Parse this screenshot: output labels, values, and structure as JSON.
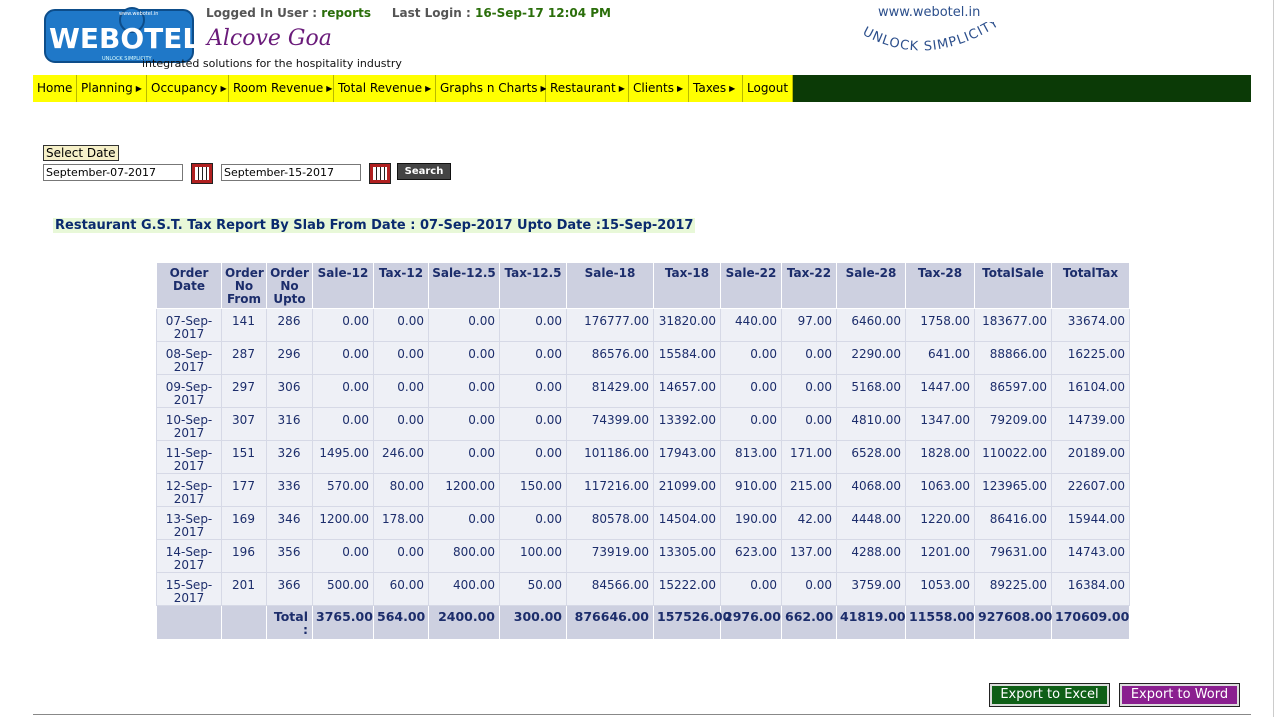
{
  "header": {
    "logo_text": "WEBOTEL",
    "logo_small_text": "www.webotel.in",
    "logo_under_text": "UNLOCK SIMPLICITY",
    "logged_in_label": "Logged In User :",
    "logged_in_user": "reports",
    "last_login_label": "Last Login :",
    "last_login_value": "16-Sep-17 12:04 PM",
    "hotel_name": "Alcove Goa",
    "tagline": "integrated solutions for the hospitality industry",
    "brand_url": "www.webotel.in",
    "brand_slogan": "UNLOCK SIMPLICITY"
  },
  "menu": [
    {
      "label": "Home",
      "has_submenu": false
    },
    {
      "label": "Planning",
      "has_submenu": true
    },
    {
      "label": "Occupancy",
      "has_submenu": true
    },
    {
      "label": "Room Revenue",
      "has_submenu": true
    },
    {
      "label": "Total Revenue",
      "has_submenu": true
    },
    {
      "label": "Graphs n Charts",
      "has_submenu": true
    },
    {
      "label": "Restaurant",
      "has_submenu": true
    },
    {
      "label": "Clients",
      "has_submenu": true
    },
    {
      "label": "Taxes",
      "has_submenu": true
    },
    {
      "label": "Logout",
      "has_submenu": false
    }
  ],
  "filter": {
    "select_date_label": "Select Date",
    "from_date": "September-07-2017",
    "to_date": "September-15-2017",
    "search_label": "Search"
  },
  "report": {
    "title": "Restaurant G.S.T. Tax Report By Slab From Date : 07-Sep-2017 Upto Date :15-Sep-2017",
    "columns": [
      "Order Date",
      "Order No From",
      "Order No Upto",
      "Sale-12",
      "Tax-12",
      "Sale-12.5",
      "Tax-12.5",
      "Sale-18",
      "Tax-18",
      "Sale-22",
      "Tax-22",
      "Sale-28",
      "Tax-28",
      "TotalSale",
      "TotalTax"
    ],
    "rows": [
      [
        "07-Sep-2017",
        "141",
        "286",
        "0.00",
        "0.00",
        "0.00",
        "0.00",
        "176777.00",
        "31820.00",
        "440.00",
        "97.00",
        "6460.00",
        "1758.00",
        "183677.00",
        "33674.00"
      ],
      [
        "08-Sep-2017",
        "287",
        "296",
        "0.00",
        "0.00",
        "0.00",
        "0.00",
        "86576.00",
        "15584.00",
        "0.00",
        "0.00",
        "2290.00",
        "641.00",
        "88866.00",
        "16225.00"
      ],
      [
        "09-Sep-2017",
        "297",
        "306",
        "0.00",
        "0.00",
        "0.00",
        "0.00",
        "81429.00",
        "14657.00",
        "0.00",
        "0.00",
        "5168.00",
        "1447.00",
        "86597.00",
        "16104.00"
      ],
      [
        "10-Sep-2017",
        "307",
        "316",
        "0.00",
        "0.00",
        "0.00",
        "0.00",
        "74399.00",
        "13392.00",
        "0.00",
        "0.00",
        "4810.00",
        "1347.00",
        "79209.00",
        "14739.00"
      ],
      [
        "11-Sep-2017",
        "151",
        "326",
        "1495.00",
        "246.00",
        "0.00",
        "0.00",
        "101186.00",
        "17943.00",
        "813.00",
        "171.00",
        "6528.00",
        "1828.00",
        "110022.00",
        "20189.00"
      ],
      [
        "12-Sep-2017",
        "177",
        "336",
        "570.00",
        "80.00",
        "1200.00",
        "150.00",
        "117216.00",
        "21099.00",
        "910.00",
        "215.00",
        "4068.00",
        "1063.00",
        "123965.00",
        "22607.00"
      ],
      [
        "13-Sep-2017",
        "169",
        "346",
        "1200.00",
        "178.00",
        "0.00",
        "0.00",
        "80578.00",
        "14504.00",
        "190.00",
        "42.00",
        "4448.00",
        "1220.00",
        "86416.00",
        "15944.00"
      ],
      [
        "14-Sep-2017",
        "196",
        "356",
        "0.00",
        "0.00",
        "800.00",
        "100.00",
        "73919.00",
        "13305.00",
        "623.00",
        "137.00",
        "4288.00",
        "1201.00",
        "79631.00",
        "14743.00"
      ],
      [
        "15-Sep-2017",
        "201",
        "366",
        "500.00",
        "60.00",
        "400.00",
        "50.00",
        "84566.00",
        "15222.00",
        "0.00",
        "0.00",
        "3759.00",
        "1053.00",
        "89225.00",
        "16384.00"
      ]
    ],
    "total_label": "Total :",
    "totals": [
      "3765.00",
      "564.00",
      "2400.00",
      "300.00",
      "876646.00",
      "157526.00",
      "2976.00",
      "662.00",
      "41819.00",
      "11558.00",
      "927608.00",
      "170609.00"
    ]
  },
  "export": {
    "excel_label": "Export to Excel",
    "word_label": "Export to Word"
  },
  "colors": {
    "menu_bg": "#ffff00",
    "menu_bar": "#0b3a06",
    "table_header": "#cdd0e0",
    "excel_button": "#0f5f17",
    "word_button": "#8a1f8f"
  }
}
